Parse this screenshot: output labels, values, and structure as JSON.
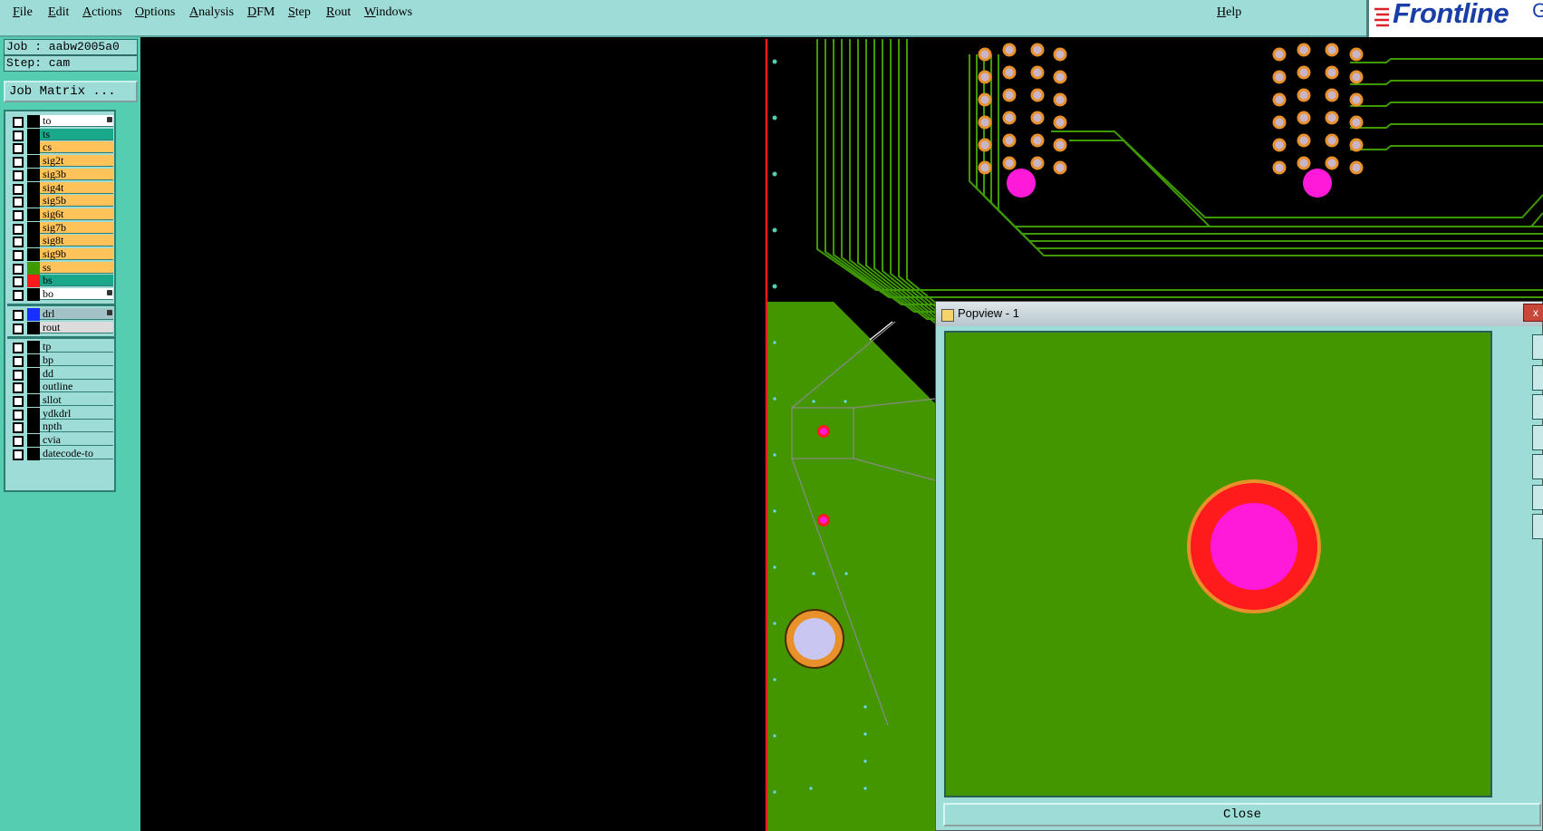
{
  "menu": {
    "items": [
      "File",
      "Edit",
      "Actions",
      "Options",
      "Analysis",
      "DFM",
      "Step",
      "Rout",
      "Windows"
    ],
    "help": "Help"
  },
  "logo": {
    "text": "Frontline",
    "suffix": "Ge"
  },
  "job_info": {
    "job": "Job : aabw2005a0",
    "step": "Step: cam"
  },
  "job_matrix_button": "Job Matrix ...",
  "layers": {
    "group1": [
      {
        "name": "to",
        "swatch": "",
        "bg": "#ffffff",
        "marker": true
      },
      {
        "name": "ts",
        "swatch": "",
        "bg": "#1aa88a",
        "marker": false
      },
      {
        "name": "cs",
        "swatch": "",
        "bg": "#ffc35a",
        "marker": false
      },
      {
        "name": "sig2t",
        "swatch": "",
        "bg": "#ffc35a",
        "marker": false
      },
      {
        "name": "sig3b",
        "swatch": "",
        "bg": "#ffc35a",
        "marker": false
      },
      {
        "name": "sig4t",
        "swatch": "",
        "bg": "#ffc35a",
        "marker": false
      },
      {
        "name": "sig5b",
        "swatch": "",
        "bg": "#ffc35a",
        "marker": false
      },
      {
        "name": "sig6t",
        "swatch": "",
        "bg": "#ffc35a",
        "marker": false
      },
      {
        "name": "sig7b",
        "swatch": "",
        "bg": "#ffc35a",
        "marker": false
      },
      {
        "name": "sig8t",
        "swatch": "",
        "bg": "#ffc35a",
        "marker": false
      },
      {
        "name": "sig9b",
        "swatch": "",
        "bg": "#ffc35a",
        "marker": false
      },
      {
        "name": "ss",
        "swatch": "#3f9a00",
        "bg": "#ffc35a",
        "marker": false
      },
      {
        "name": "bs",
        "swatch": "#ff1b1b",
        "bg": "#1aa88a",
        "marker": false
      },
      {
        "name": "bo",
        "swatch": "",
        "bg": "#ffffff",
        "marker": true
      }
    ],
    "group2": [
      {
        "name": "drl",
        "swatch": "#1730ff",
        "bg": "#a3c2c8",
        "marker": true
      },
      {
        "name": "rout",
        "swatch": "",
        "bg": "#dcdcdc",
        "marker": false
      }
    ],
    "group3": [
      {
        "name": "tp",
        "swatch": "",
        "bg": "#9edcd8",
        "marker": false
      },
      {
        "name": "bp",
        "swatch": "",
        "bg": "#9edcd8",
        "marker": false
      },
      {
        "name": "dd",
        "swatch": "",
        "bg": "#9edcd8",
        "marker": false
      },
      {
        "name": "outline",
        "swatch": "",
        "bg": "#9edcd8",
        "marker": false
      },
      {
        "name": "sllot",
        "swatch": "",
        "bg": "#9edcd8",
        "marker": false
      },
      {
        "name": "ydkdrl",
        "swatch": "",
        "bg": "#9edcd8",
        "marker": false
      },
      {
        "name": "npth",
        "swatch": "",
        "bg": "#9edcd8",
        "marker": false
      },
      {
        "name": "cvia",
        "swatch": "",
        "bg": "#9edcd8",
        "marker": false
      },
      {
        "name": "datecode-to",
        "swatch": "",
        "bg": "#9edcd8",
        "marker": false
      }
    ]
  },
  "popview": {
    "title": "Popview - 1",
    "close_x": "x",
    "close_button": "Close"
  },
  "colors": {
    "board_green": "#439600",
    "trace_green": "#3f9a00",
    "pad_orange": "#e8902a",
    "pad_fill": "#c9b4c8",
    "via_magenta": "#ff1ad9",
    "outline_red": "#ff1b1b",
    "panel_teal": "#55cdb0",
    "menu_teal": "#9edcd8"
  }
}
